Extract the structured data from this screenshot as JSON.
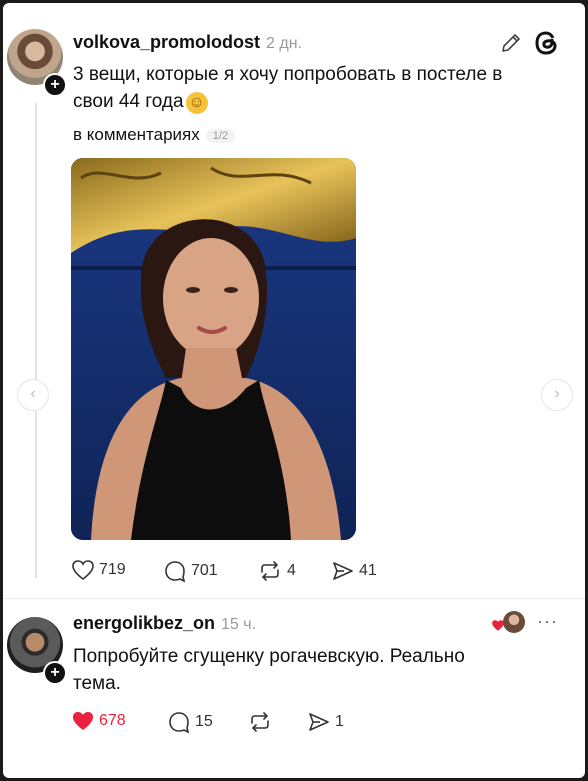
{
  "post": {
    "username": "volkova_promolodost",
    "time": "2 дн.",
    "text_line1": "3 вещи, которые я хочу попробовать в постеле в",
    "text_line2": "свои 44 года",
    "emoji": "☺",
    "subtext": "в комментариях",
    "counter": "1/2",
    "likes": "719",
    "comments": "701",
    "reposts": "4",
    "shares": "41"
  },
  "reply": {
    "username": "energolikbez_on",
    "time": "15 ч.",
    "text_line1": "Попробуйте сгущенку рогачевскую. Реально",
    "text_line2": "тема.",
    "likes": "678",
    "comments": "15",
    "reposts": "",
    "shares": "1",
    "more": "···"
  },
  "icons": [
    "edit-icon",
    "threads-logo-icon",
    "heart-icon",
    "comment-icon",
    "repost-icon",
    "share-icon"
  ],
  "colors": {
    "like_active": "#e8223f",
    "text": "#111111",
    "muted": "#999999"
  }
}
